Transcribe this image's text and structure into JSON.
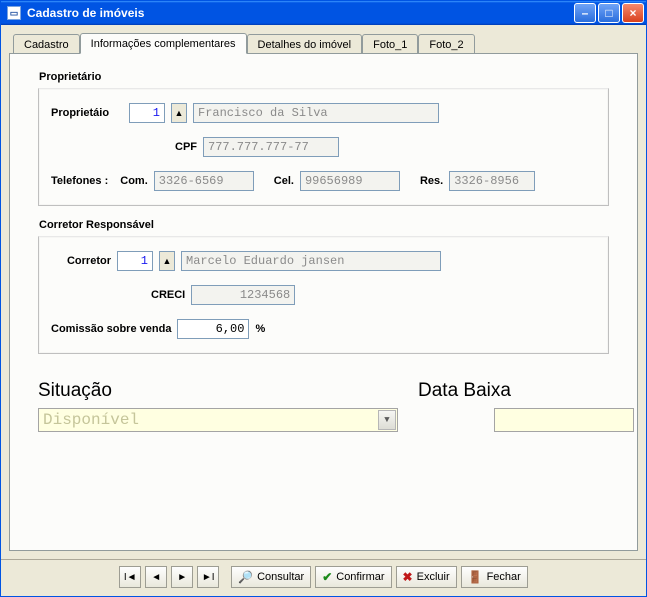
{
  "window": {
    "title": "Cadastro de imóveis"
  },
  "tabs": [
    "Cadastro",
    "Informações complementares",
    "Detalhes do imóvel",
    "Foto_1",
    "Foto_2"
  ],
  "active_tab": 1,
  "groups": {
    "prop": {
      "title": "Proprietário",
      "owner_label": "Proprietáio",
      "owner_id": "1",
      "owner_name": "Francisco da Silva",
      "cpf_label": "CPF",
      "cpf": "777.777.777-77",
      "tel_label": "Telefones :",
      "com_label": "Com.",
      "com": "3326-6569",
      "cel_label": "Cel.",
      "cel": "99656989",
      "res_label": "Res.",
      "res": "3326-8956"
    },
    "corr": {
      "title": "Corretor Responsável",
      "corr_label": "Corretor",
      "corr_id": "1",
      "corr_name": "Marcelo Eduardo jansen",
      "creci_label": "CRECI",
      "creci": "1234568",
      "comis_label": "Comissão sobre venda",
      "comis_value": "6,00",
      "comis_pct": "%"
    }
  },
  "situacao": {
    "label": "Situação",
    "value": "Disponível"
  },
  "databaixa": {
    "label": "Data Baixa",
    "value": ""
  },
  "toolbar": {
    "consultar": "Consultar",
    "confirmar": "Confirmar",
    "excluir": "Excluir",
    "fechar": "Fechar"
  }
}
